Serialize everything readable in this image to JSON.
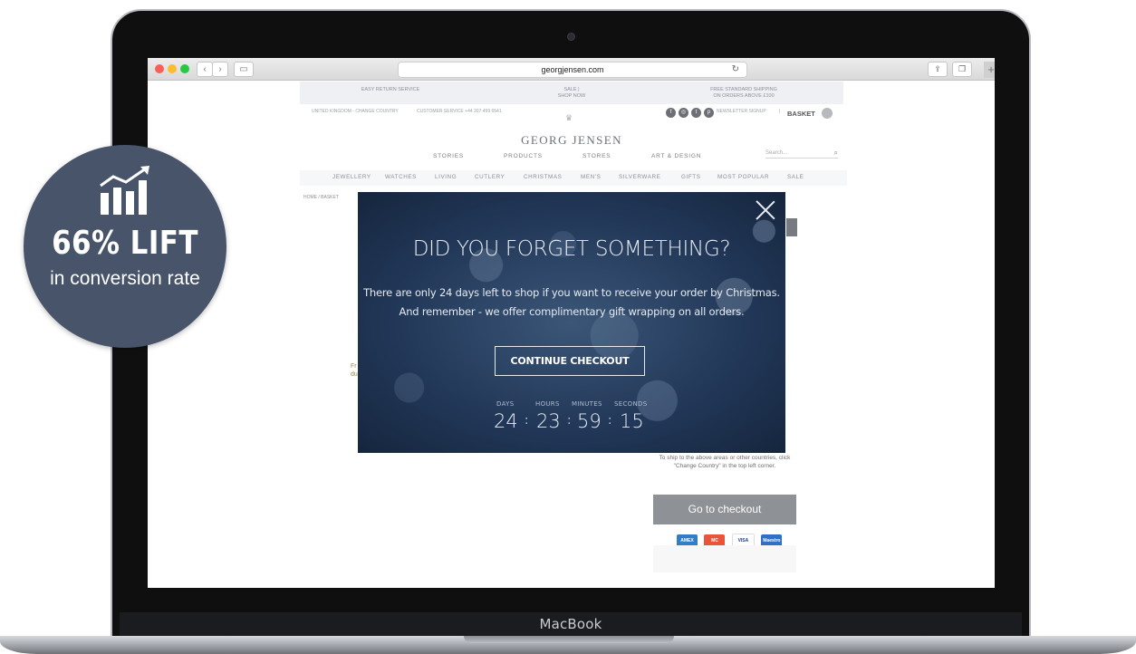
{
  "laptop": {
    "label": "MacBook"
  },
  "browser": {
    "url": "georgjensen.com",
    "reload_icon": "reload-icon"
  },
  "promo": {
    "left": "EASY RETURN SERVICE",
    "center_line1": "SALE |",
    "center_line2": "SHOP NOW",
    "right_line1": "FREE STANDARD SHIPPING",
    "right_line2": "ON ORDERS ABOVE £100"
  },
  "utility": {
    "country": "UNITED KINGDOM - CHANGE COUNTRY",
    "service": "CUSTOMER SERVICE +44 207 499 6541",
    "newsletter": "NEWSLETTER SIGNUP",
    "basket": "BASKET"
  },
  "brand": {
    "name": "GEORG JENSEN"
  },
  "topnav": [
    "STORIES",
    "PRODUCTS",
    "STORES",
    "ART & DESIGN"
  ],
  "search": {
    "placeholder": "Search..."
  },
  "categories": [
    "JEWELLERY",
    "WATCHES",
    "LIVING",
    "CUTLERY",
    "CHRISTMAS",
    "MEN'S",
    "SILVERWARE",
    "GIFTS",
    "MOST POPULAR",
    "SALE"
  ],
  "breadcrumb": "HOME / BASKET",
  "page": {
    "fragment_line1": "Fr",
    "fragment_line2": "du",
    "shipping_note": "To ship to the above areas or other countries, click \"Change Country\" in the top left corner.",
    "checkout_label": "Go to checkout",
    "cards": [
      "AMEX",
      "MC",
      "VISA",
      "Maestro"
    ]
  },
  "modal": {
    "title": "DID YOU FORGET SOMETHING?",
    "body_line1": "There are only 24 days left to shop if you want to receive your order by Christmas.",
    "body_line2": "And remember - we offer complimentary gift wrapping on all orders.",
    "cta": "CONTINUE CHECKOUT",
    "countdown": {
      "days_label": "DAYS",
      "hours_label": "HOURS",
      "minutes_label": "MINUTES",
      "seconds_label": "SECONDS",
      "days": "24",
      "hours": "23",
      "minutes": "59",
      "seconds": "15"
    }
  },
  "badge": {
    "title": "66% LIFT",
    "subtitle": "in conversion rate",
    "icon": "growth-chart-icon"
  }
}
